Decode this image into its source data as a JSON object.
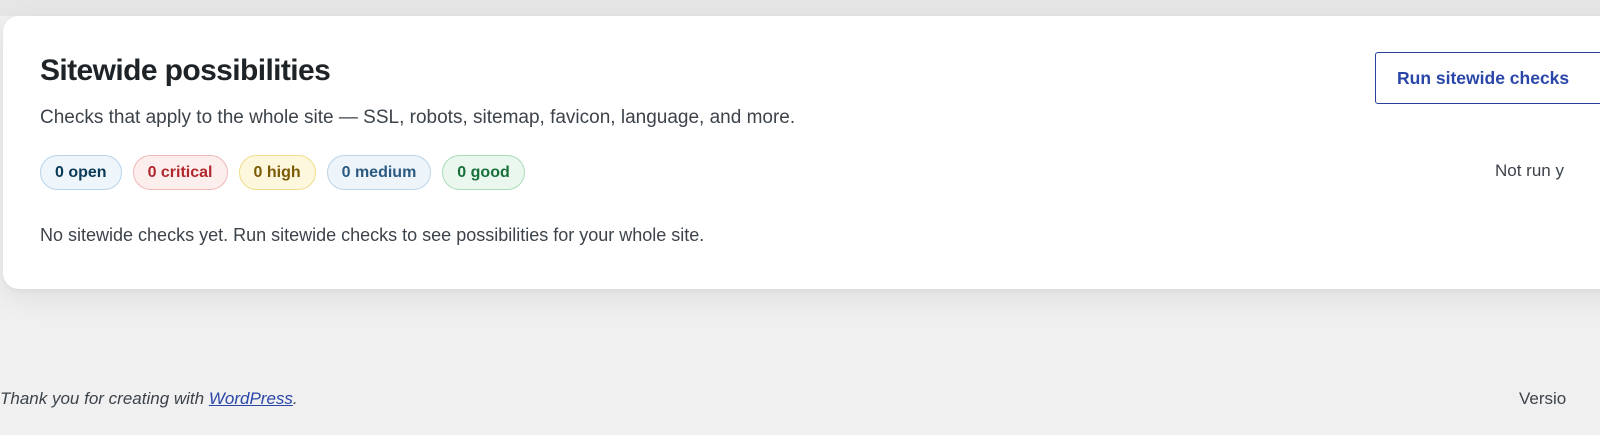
{
  "section": {
    "title": "Sitewide possibilities",
    "description": "Checks that apply to the whole site — SSL, robots, sitemap, favicon, language, and more.",
    "badges": [
      {
        "label": "0 open",
        "kind": "open",
        "color": "#0b3a57"
      },
      {
        "label": "0 critical",
        "kind": "critical",
        "color": "#b0282d"
      },
      {
        "label": "0 high",
        "kind": "high",
        "color": "#7a5a04"
      },
      {
        "label": "0 medium",
        "kind": "medium",
        "color": "#2c5a80"
      },
      {
        "label": "0 good",
        "kind": "good",
        "color": "#17703a"
      }
    ],
    "empty_message": "No sitewide checks yet. Run sitewide checks to see possibilities for your whole site.",
    "run_button_label": "Run sitewide checks",
    "status_text": "Not run y"
  },
  "footer": {
    "thanks_prefix": "Thank you for creating with ",
    "thanks_link": "WordPress",
    "thanks_suffix": ".",
    "version_text": "Versio"
  },
  "colors": {
    "accent": "#2a46a8",
    "page_background": "#f0f0f1",
    "card_background": "#ffffff"
  }
}
